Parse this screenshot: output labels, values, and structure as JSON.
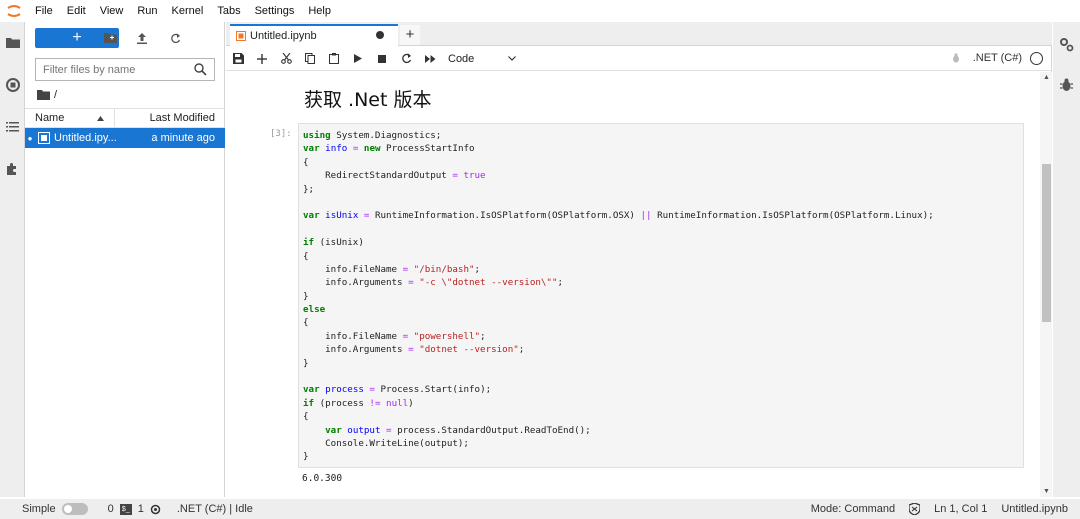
{
  "menu": {
    "items": [
      "File",
      "Edit",
      "View",
      "Run",
      "Kernel",
      "Tabs",
      "Settings",
      "Help"
    ]
  },
  "filebrowser": {
    "new_label": "+",
    "search_placeholder": "Filter files by name",
    "breadcrumb": "/",
    "columns": {
      "name": "Name",
      "modified": "Last Modified"
    },
    "files": [
      {
        "name": "Untitled.ipy...",
        "modified": "a minute ago"
      }
    ]
  },
  "tab": {
    "title": "Untitled.ipynb",
    "add_label": "+"
  },
  "toolbar": {
    "cell_type": "Code",
    "kernel_name": ".NET (C#)"
  },
  "notebook": {
    "heading": "获取 .Net 版本",
    "prompt": "[3]:",
    "code_lines": [
      "using System.Diagnostics;",
      "var info = new ProcessStartInfo",
      "{",
      "    RedirectStandardOutput = true",
      "};",
      "",
      "var isUnix = RuntimeInformation.IsOSPlatform(OSPlatform.OSX) || RuntimeInformation.IsOSPlatform(OSPlatform.Linux);",
      "",
      "if (isUnix)",
      "{",
      "    info.FileName = \"/bin/bash\";",
      "    info.Arguments = \"-c \\\"dotnet --version\\\"\";",
      "}",
      "else",
      "{",
      "    info.FileName = \"powershell\";",
      "    info.Arguments = \"dotnet --version\";",
      "}",
      "",
      "var process = Process.Start(info);",
      "if (process != null)",
      "{",
      "    var output = process.StandardOutput.ReadToEnd();",
      "    Console.WriteLine(output);",
      "}"
    ],
    "output": "6.0.300"
  },
  "statusbar": {
    "mode_label": "Simple",
    "terminals_count": "0",
    "kernels_count": "1",
    "kernel_status": ".NET (C#) | Idle",
    "command_mode": "Mode: Command",
    "cursor": "Ln 1, Col 1",
    "filename": "Untitled.ipynb"
  },
  "colors": {
    "accent": "#1976d2",
    "keyword": "#008000",
    "string": "#ba2121",
    "variable": "#0000ff"
  }
}
